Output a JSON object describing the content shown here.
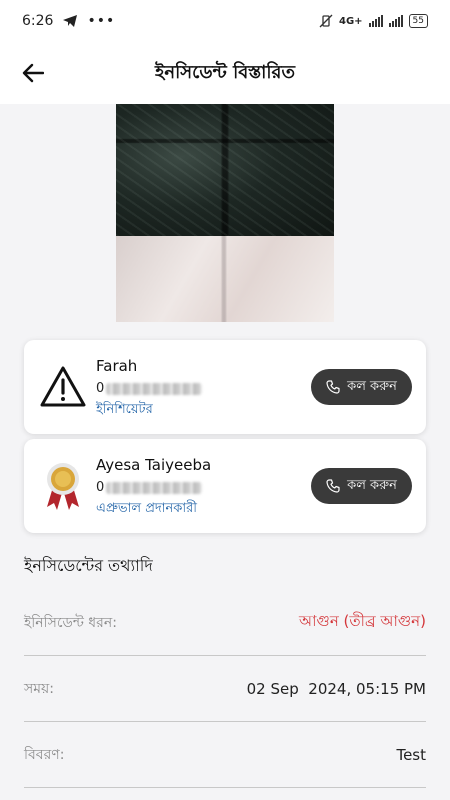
{
  "status_bar": {
    "time": "6:26",
    "network": "4G+",
    "battery": "55"
  },
  "header": {
    "title": "ইনসিডেন্ট বিস্তারিত"
  },
  "contacts": [
    {
      "name": "Farah",
      "phone_visible_prefix": "0",
      "role": "ইনিশিয়েটর",
      "call_label": "কল করুন",
      "icon": "warning-icon"
    },
    {
      "name": "Ayesa Taiyeeba",
      "phone_visible_prefix": "0",
      "role": "এপ্রুভাল প্রদানকারী",
      "call_label": "কল করুন",
      "icon": "award-badge-icon"
    }
  ],
  "details": {
    "section_title": "ইনসিডেন্টের তথ্যাদি",
    "rows": [
      {
        "label": "ইনিসিডেন্ট ধরন:",
        "value": "আগুন (তীব্র আগুন)"
      },
      {
        "label": "সময়:",
        "value": "02 Sep  2024, 05:15 PM"
      },
      {
        "label": "বিবরণ:",
        "value": "Test"
      }
    ]
  },
  "colors": {
    "role_text": "#2465a8",
    "danger_text": "#d4363a",
    "call_button_bg": "#3a3a3a"
  }
}
